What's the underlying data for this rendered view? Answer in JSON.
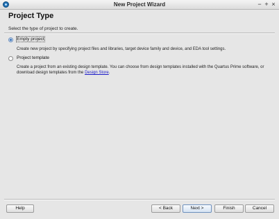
{
  "window": {
    "title": "New Project Wizard",
    "controls": {
      "minimize": "−",
      "maximize": "+",
      "close": "×"
    }
  },
  "header": {
    "title": "Project Type",
    "subtitle": "Select the type of project to create."
  },
  "options": {
    "empty": {
      "label": "Empty project",
      "selected": true,
      "description": "Create new project by specifying project files and libraries, target device family and device, and EDA tool settings."
    },
    "template": {
      "label": "Project template",
      "selected": false,
      "description_text": "Create a project from an existing design template. You can choose from design templates installed with the Quartus Prime software, or download design templates from the",
      "link": "Design Store",
      "end": "."
    }
  },
  "buttons": {
    "help": "Help",
    "back": "< Back",
    "next": "Next >",
    "finish": "Finish",
    "cancel": "Cancel"
  }
}
